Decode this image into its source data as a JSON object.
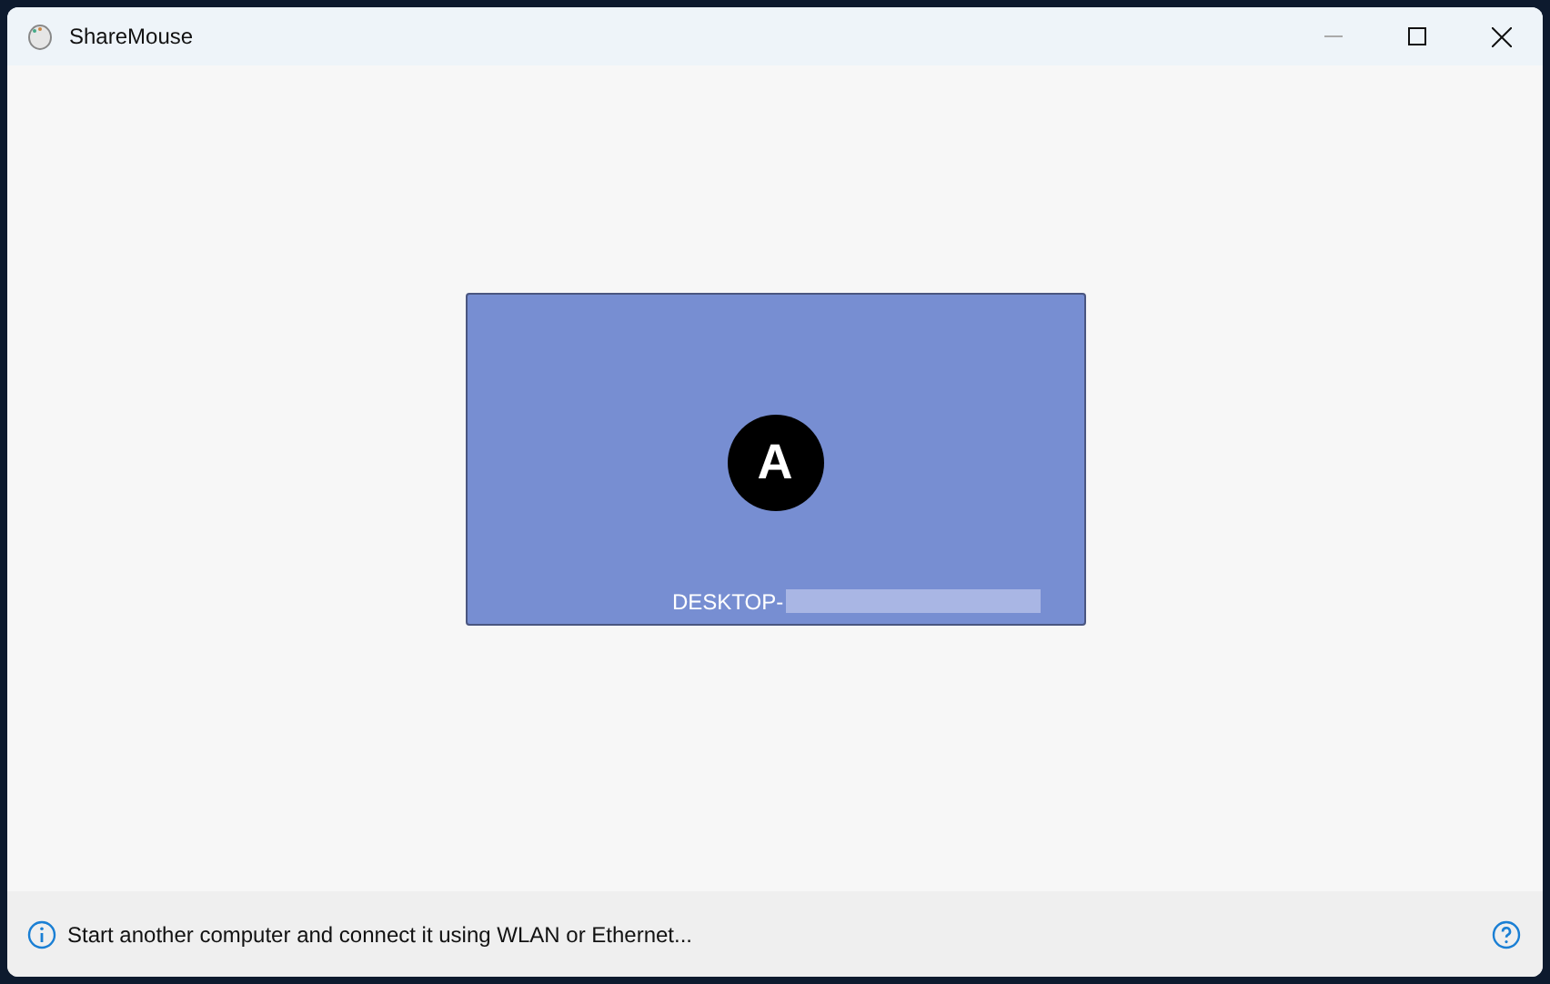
{
  "window": {
    "title": "ShareMouse"
  },
  "computers": [
    {
      "letter": "A",
      "name": "DESKTOP-",
      "name_redacted": true,
      "color": "#778ed2"
    }
  ],
  "status_bar": {
    "message": "Start another computer and connect it using WLAN or Ethernet..."
  }
}
